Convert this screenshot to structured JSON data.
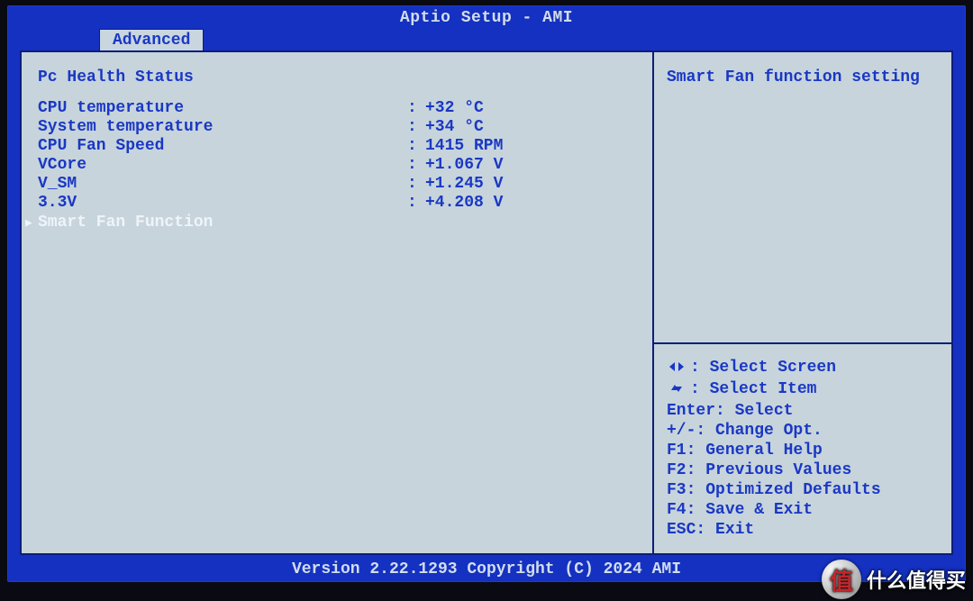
{
  "title": "Aptio Setup - AMI",
  "tab": "Advanced",
  "section": "Pc Health Status",
  "rows": [
    {
      "label": "CPU temperature",
      "value": "+32 °C"
    },
    {
      "label": "System temperature",
      "value": "+34 °C"
    },
    {
      "label": "CPU Fan Speed",
      "value": "1415 RPM"
    },
    {
      "label": "VCore",
      "value": "+1.067 V"
    },
    {
      "label": "V_SM",
      "value": "+1.245 V"
    },
    {
      "label": "3.3V",
      "value": "+4.208 V"
    }
  ],
  "selected_item": "Smart Fan Function",
  "help_text": "Smart Fan function setting",
  "keys": [
    {
      "key": "lr",
      "text": "Select Screen"
    },
    {
      "key": "ud",
      "text": "Select Item"
    },
    {
      "key": "Enter:",
      "text": "Select"
    },
    {
      "key": "+/-:",
      "text": "Change Opt."
    },
    {
      "key": "F1:",
      "text": "General Help"
    },
    {
      "key": "F2:",
      "text": "Previous Values"
    },
    {
      "key": "F3:",
      "text": "Optimized Defaults"
    },
    {
      "key": "F4:",
      "text": "Save & Exit"
    },
    {
      "key": "ESC:",
      "text": "Exit"
    }
  ],
  "footer": "Version 2.22.1293 Copyright (C) 2024 AMI",
  "watermark": {
    "badge": "值",
    "text": "什么值得买"
  }
}
